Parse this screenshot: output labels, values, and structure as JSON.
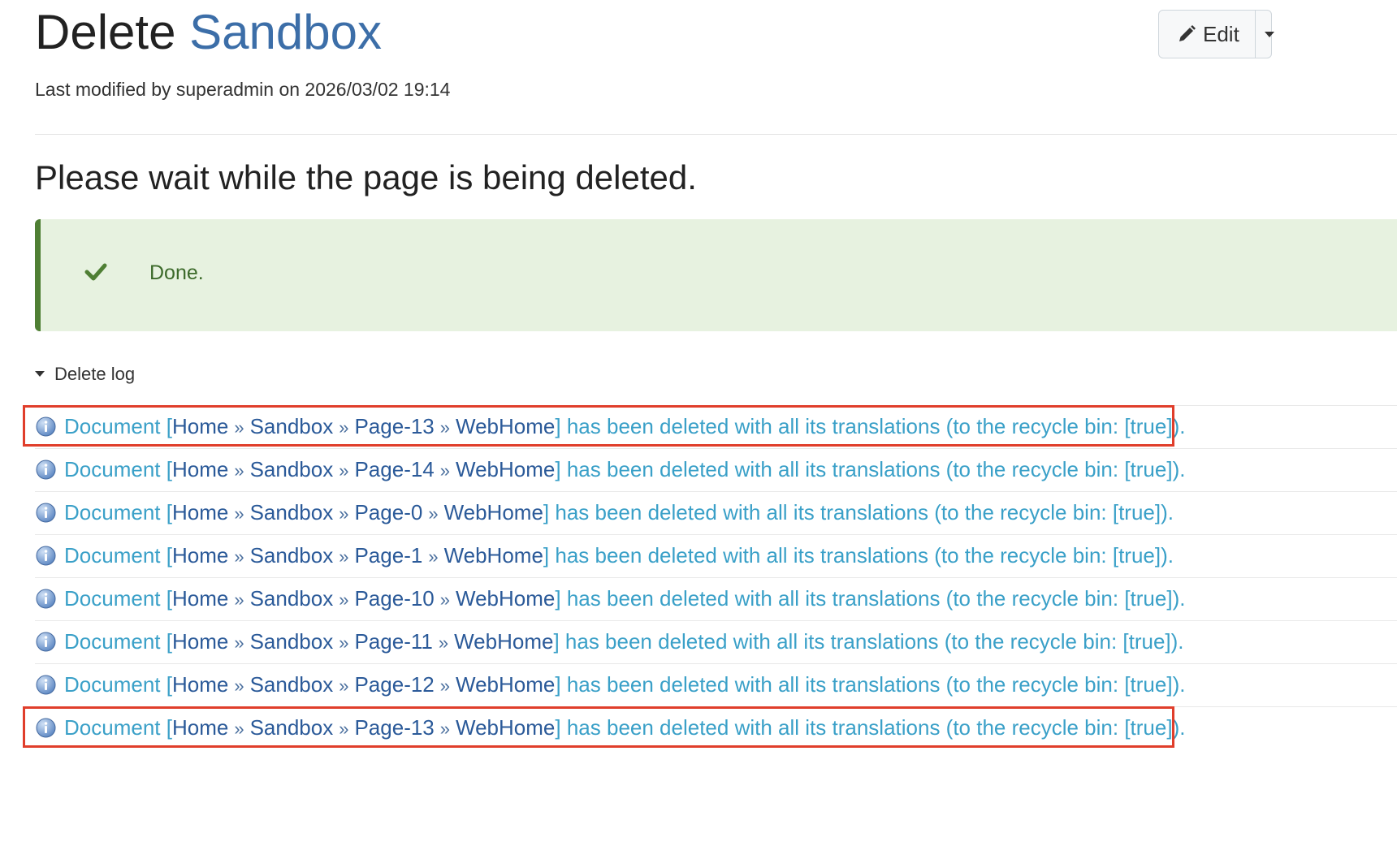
{
  "header": {
    "title_action": "Delete",
    "title_page": "Sandbox",
    "last_modified": "Last modified by superadmin on 2026/03/02 19:14",
    "edit_label": "Edit"
  },
  "job": {
    "heading": "Please wait while the page is being deleted.",
    "status": "Done."
  },
  "log": {
    "toggle_label": "Delete log",
    "separator": "»",
    "prefix": "Document [",
    "suffix": "] has been deleted with all its translations (to the recycle bin: [true]).",
    "entries": [
      {
        "path": [
          "Home",
          "Sandbox",
          "Page-13",
          "WebHome"
        ],
        "highlighted": true
      },
      {
        "path": [
          "Home",
          "Sandbox",
          "Page-14",
          "WebHome"
        ],
        "highlighted": false
      },
      {
        "path": [
          "Home",
          "Sandbox",
          "Page-0",
          "WebHome"
        ],
        "highlighted": false
      },
      {
        "path": [
          "Home",
          "Sandbox",
          "Page-1",
          "WebHome"
        ],
        "highlighted": false
      },
      {
        "path": [
          "Home",
          "Sandbox",
          "Page-10",
          "WebHome"
        ],
        "highlighted": false
      },
      {
        "path": [
          "Home",
          "Sandbox",
          "Page-11",
          "WebHome"
        ],
        "highlighted": false
      },
      {
        "path": [
          "Home",
          "Sandbox",
          "Page-12",
          "WebHome"
        ],
        "highlighted": false
      },
      {
        "path": [
          "Home",
          "Sandbox",
          "Page-13",
          "WebHome"
        ],
        "highlighted": true
      }
    ]
  },
  "colors": {
    "title_link": "#3c6ea8",
    "log_text": "#3aa0c8",
    "log_crumb": "#2b5a99",
    "success_bg": "#e7f2e0",
    "success_border": "#4f7f34",
    "highlight_box": "#e03e2b"
  },
  "icons": {
    "status": "checkmark-icon",
    "log_entry": "info-icon",
    "edit": "pencil-icon",
    "toggle": "caret-down-icon",
    "dropdown": "chevron-down-icon"
  }
}
